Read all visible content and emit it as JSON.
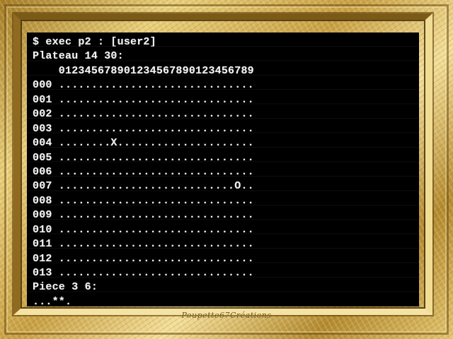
{
  "terminal": {
    "lines": [
      "$ exec p2 : [user2]",
      "Plateau 14 30:",
      "    012345678901234567890123456789",
      "000 ..............................",
      "001 ..............................",
      "002 ..............................",
      "003 ..............................",
      "004 ........X.....................",
      "005 ..............................",
      "006 ..............................",
      "007 ...........................O..",
      "008 ..............................",
      "009 ..............................",
      "010 ..............................",
      "011 ..............................",
      "012 ..............................",
      "013 ..............................",
      "Piece 3 6:",
      "...**."
    ]
  },
  "watermark": "Poupette67Créations",
  "colors": {
    "terminal_bg": "#000000",
    "terminal_text": "#f2f2f2",
    "frame_gold": "#d8b65a"
  }
}
